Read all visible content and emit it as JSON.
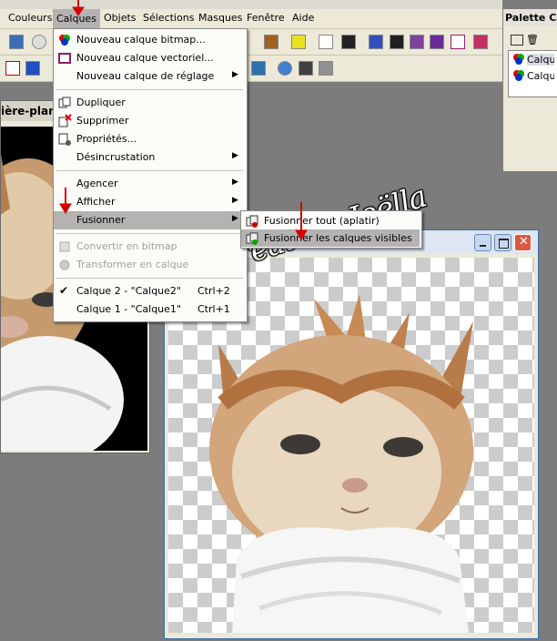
{
  "menubar": {
    "items": [
      "Couleurs",
      "Calques",
      "Objets",
      "Sélections",
      "Masques",
      "Fenêtre",
      "Aide"
    ]
  },
  "palette": {
    "title": "Palette Ca",
    "rows": [
      "Calqu",
      "Calqu"
    ]
  },
  "left_window": {
    "title": "ière-plan)"
  },
  "calques_menu": {
    "items": [
      {
        "label": "Nouveau calque bitmap...",
        "icon": "new-bitmap-layer-icon"
      },
      {
        "label": "Nouveau calque vectoriel...",
        "icon": "new-vector-layer-icon"
      },
      {
        "label": "Nouveau calque de réglage",
        "submenu": true
      },
      {
        "label": "Dupliquer",
        "icon": "duplicate-icon"
      },
      {
        "label": "Supprimer",
        "icon": "delete-layer-icon"
      },
      {
        "label": "Propriétés...",
        "icon": "properties-icon"
      },
      {
        "label": "Désincrustation",
        "submenu": true
      },
      {
        "label": "Agencer",
        "submenu": true
      },
      {
        "label": "Afficher",
        "submenu": true
      },
      {
        "label": "Fusionner",
        "submenu": true,
        "highlighted": true
      },
      {
        "label": "Convertir en bitmap",
        "disabled": true
      },
      {
        "label": "Transformer en calque",
        "disabled": true
      },
      {
        "label": "Calque 2 - \"Calque2\"",
        "shortcut": "Ctrl+2",
        "checked": true
      },
      {
        "label": "Calque 1 - \"Calque1\"",
        "shortcut": "Ctrl+1"
      }
    ]
  },
  "fusionner_submenu": {
    "items": [
      {
        "label": "Fusionner tout (aplatir)"
      },
      {
        "label": "Fusionner les calques visibles",
        "highlighted": true
      }
    ]
  },
  "watermark": {
    "text": "CréationsJoëlla"
  },
  "colors": {
    "menu_highlight": "#b4b3b1",
    "red_arrow": "#d40000",
    "menubar_bg": "#ece9d8"
  }
}
